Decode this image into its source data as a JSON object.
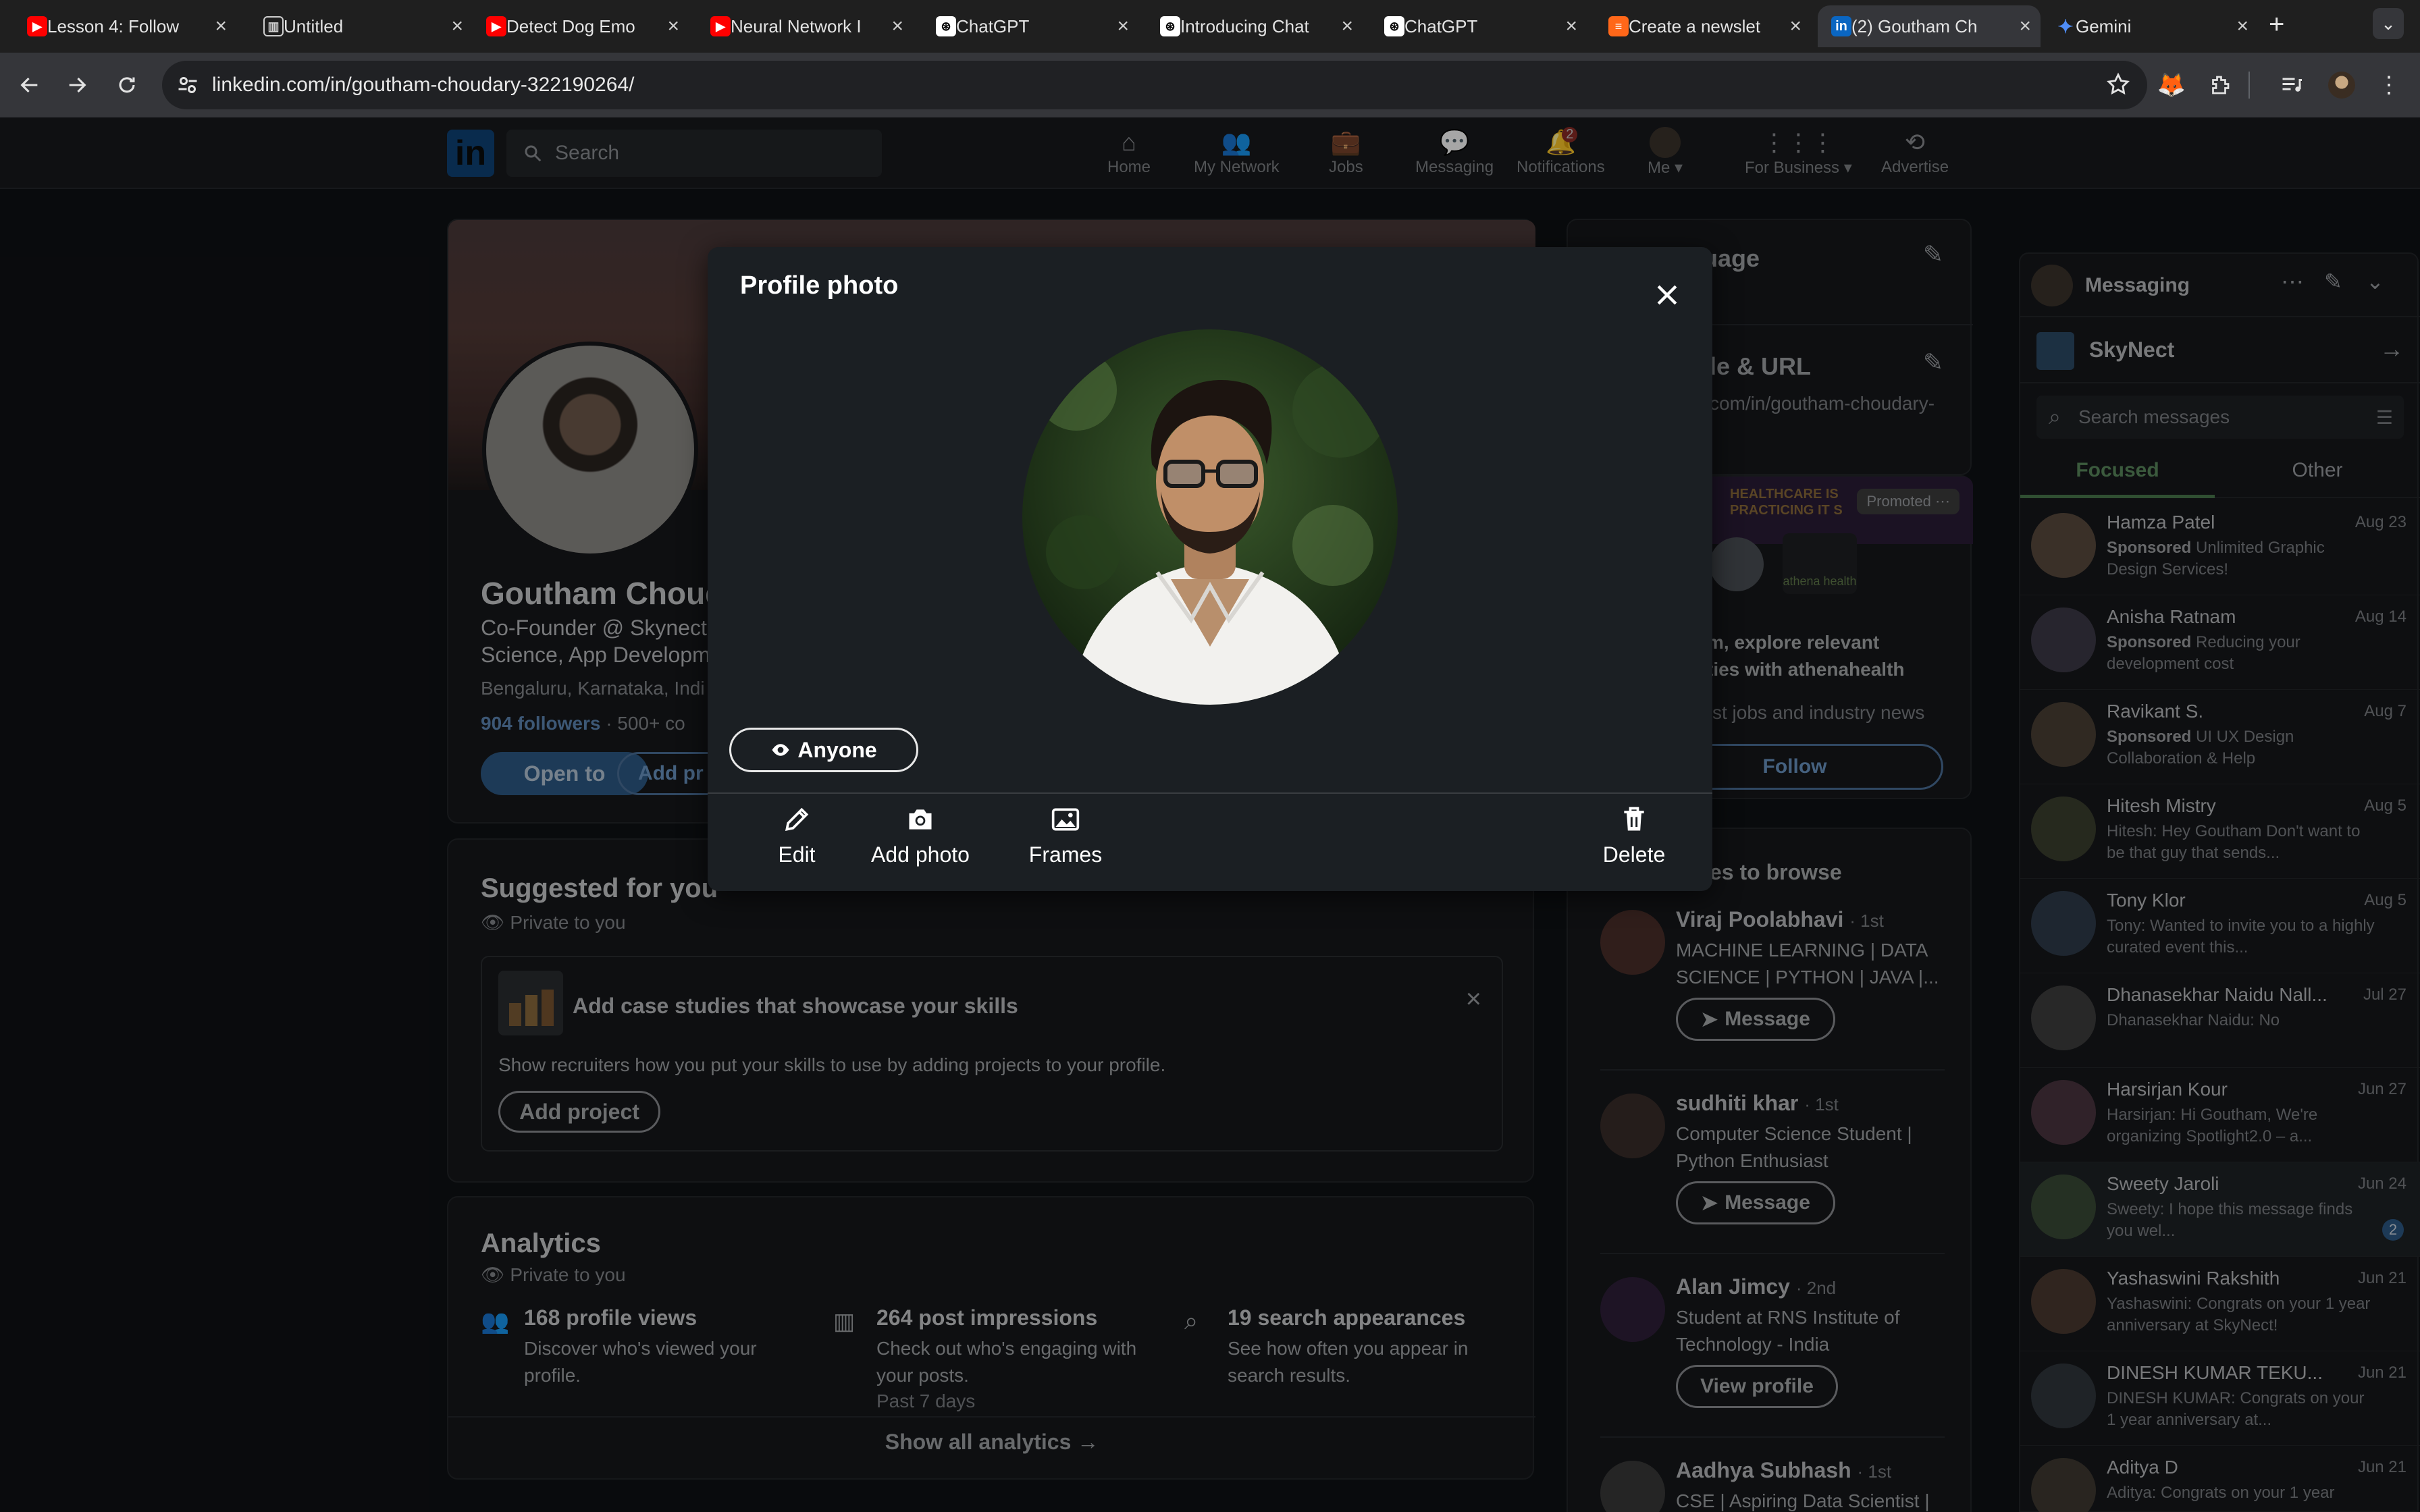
{
  "browser": {
    "tabs": [
      {
        "title": "Lesson 4: Follow",
        "icon": "youtube-icon",
        "color": "#ff0000"
      },
      {
        "title": "Untitled",
        "icon": "doc-icon",
        "color": "#cfcfcf"
      },
      {
        "title": "Detect Dog Emo",
        "icon": "youtube-icon",
        "color": "#ff0000"
      },
      {
        "title": "Neural Network I",
        "icon": "youtube-icon",
        "color": "#ff0000"
      },
      {
        "title": "ChatGPT",
        "icon": "chatgpt-icon",
        "color": "#ffffff"
      },
      {
        "title": "Introducing Chat",
        "icon": "chatgpt-icon",
        "color": "#ffffff"
      },
      {
        "title": "ChatGPT",
        "icon": "chatgpt-icon",
        "color": "#ffffff"
      },
      {
        "title": "Create a newslet",
        "icon": "substack-icon",
        "color": "#ff6719"
      },
      {
        "title": "(2) Goutham Ch",
        "icon": "linkedin-icon",
        "color": "#0a66c2"
      },
      {
        "title": "Gemini",
        "icon": "gemini-icon",
        "color": "#4f8df7"
      }
    ],
    "url": "linkedin.com/in/goutham-choudary-322190264/"
  },
  "linkedin_nav": {
    "search_placeholder": "Search",
    "items": [
      {
        "label": "Home",
        "icon": "home-icon"
      },
      {
        "label": "My Network",
        "icon": "network-icon"
      },
      {
        "label": "Jobs",
        "icon": "briefcase-icon"
      },
      {
        "label": "Messaging",
        "icon": "chat-icon"
      },
      {
        "label": "Notifications",
        "icon": "bell-icon",
        "badge": "2"
      },
      {
        "label": "Me",
        "icon": "avatar-icon"
      },
      {
        "label": "For Business",
        "icon": "grid-icon"
      },
      {
        "label": "Advertise",
        "icon": "advertise-icon"
      }
    ]
  },
  "profile": {
    "name": "Goutham Choud",
    "headline_1": "Co-Founder @ Skynect",
    "headline_2": "Science, App Developm",
    "location": "Bengaluru, Karnataka, Indi",
    "followers": "904 followers",
    "connections": "· 500+ co",
    "open_to": "Open to",
    "add_profile": "Add pr"
  },
  "suggested": {
    "title": "Suggested for you",
    "private": "Private to you",
    "case_title": "Add case studies that showcase your skills",
    "case_desc": "Show recruiters how you put your skills to use by adding projects to your profile.",
    "add_project": "Add project"
  },
  "analytics": {
    "title": "Analytics",
    "private": "Private to you",
    "items": [
      {
        "title": "168 profile views",
        "desc": "Discover who's viewed your profile."
      },
      {
        "title": "264 post impressions",
        "desc": "Check out who's engaging with your posts.",
        "sub": "Past 7 days"
      },
      {
        "title": "19 search appearances",
        "desc": "See how often you appear in search results."
      }
    ],
    "show_all": "Show all analytics →"
  },
  "right_col": {
    "language": "uage",
    "profile_url_title": "ile & URL",
    "profile_url": "com/in/goutham-choudary-",
    "ad_banner": "HEALTHCARE IS PRACTICING IT S",
    "promoted": "Promoted",
    "ad_brand": "athena health",
    "ad_text_1": "m, explore relevant",
    "ad_text_2": "ties with athenahealth",
    "ad_text_3": "st jobs and industry news",
    "follow": "Follow",
    "browse_title": "es to browse",
    "people": [
      {
        "name": "Viraj Poolabhavi",
        "degree": "· 1st",
        "desc": "MACHINE LEARNING | DATA SCIENCE | PYTHON | JAVA |...",
        "action": "Message"
      },
      {
        "name": "sudhiti khar",
        "degree": "· 1st",
        "desc": "Computer Science Student | Python Enthusiast",
        "action": "Message"
      },
      {
        "name": "Alan Jimcy",
        "degree": "· 2nd",
        "desc": "Student at RNS Institute of Technology - India",
        "action": "View profile"
      },
      {
        "name": "Aadhya Subhash",
        "degree": "· 1st",
        "desc": "CSE | Aspiring Data Scientist |",
        "action": ""
      }
    ]
  },
  "messaging": {
    "title": "Messaging",
    "org": "SkyNect",
    "search_placeholder": "Search messages",
    "tab_focused": "Focused",
    "tab_other": "Other",
    "threads": [
      {
        "name": "Hamza Patel",
        "date": "Aug 23",
        "tag": "Sponsored",
        "preview": "Unlimited Graphic Design Services!"
      },
      {
        "name": "Anisha Ratnam",
        "date": "Aug 14",
        "tag": "Sponsored",
        "preview": "Reducing your development cost"
      },
      {
        "name": "Ravikant S.",
        "date": "Aug 7",
        "tag": "Sponsored",
        "preview": "UI UX Design Collaboration & Help"
      },
      {
        "name": "Hitesh Mistry",
        "date": "Aug 5",
        "tag": "",
        "preview": "Hitesh: Hey Goutham Don't want to be that guy that sends..."
      },
      {
        "name": "Tony Klor",
        "date": "Aug 5",
        "tag": "",
        "preview": "Tony: Wanted to invite you to a highly curated event this..."
      },
      {
        "name": "Dhanasekhar Naidu Nall...",
        "date": "Jul 27",
        "tag": "",
        "preview": "Dhanasekhar Naidu: No"
      },
      {
        "name": "Harsirjan Kour",
        "date": "Jun 27",
        "tag": "",
        "preview": "Harsirjan: Hi Goutham, We're organizing Spotlight2.0 – a..."
      },
      {
        "name": "Sweety Jaroli",
        "date": "Jun 24",
        "tag": "",
        "preview": "Sweety: I hope this message finds you wel...",
        "unread": "2"
      },
      {
        "name": "Yashaswini Rakshith",
        "date": "Jun 21",
        "tag": "",
        "preview": "Yashaswini: Congrats on your 1 year anniversary at SkyNect!"
      },
      {
        "name": "DINESH KUMAR TEKU...",
        "date": "Jun 21",
        "tag": "",
        "preview": "DINESH KUMAR: Congrats on your 1 year anniversary at..."
      },
      {
        "name": "Aditya D",
        "date": "Jun 21",
        "tag": "",
        "preview": "Aditya: Congrats on your 1 year"
      }
    ]
  },
  "modal": {
    "title": "Profile photo",
    "visibility": "Anyone",
    "actions": [
      {
        "label": "Edit",
        "icon": "pencil-icon"
      },
      {
        "label": "Add photo",
        "icon": "camera-icon"
      },
      {
        "label": "Frames",
        "icon": "image-icon"
      },
      {
        "label": "Delete",
        "icon": "trash-icon"
      }
    ]
  }
}
